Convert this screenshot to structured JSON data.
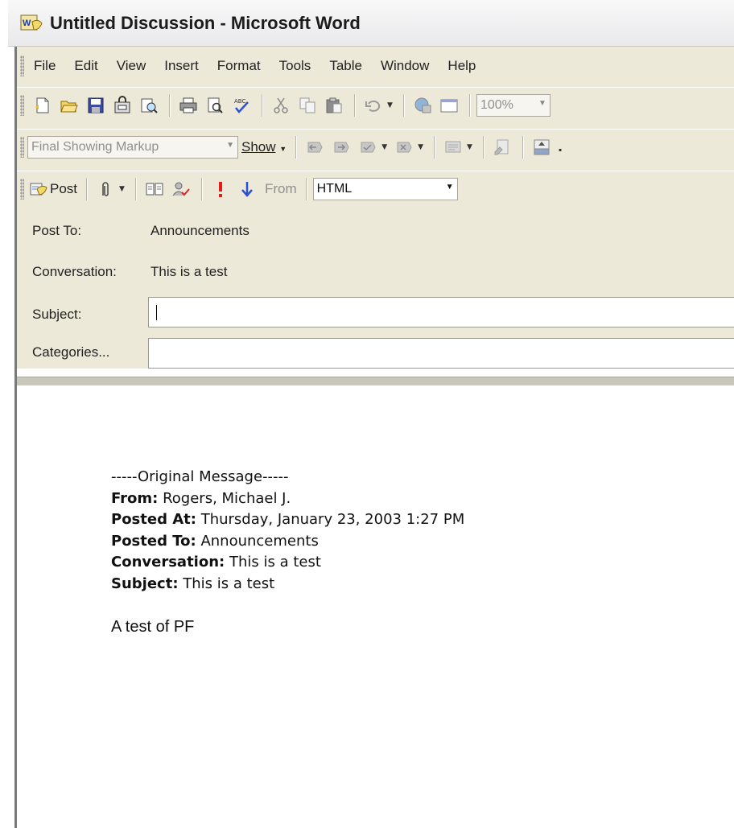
{
  "window": {
    "title": "Untitled Discussion - Microsoft Word",
    "app_icon": "word-discussion-icon"
  },
  "menubar": {
    "items": [
      "File",
      "Edit",
      "View",
      "Insert",
      "Format",
      "Tools",
      "Table",
      "Window",
      "Help"
    ]
  },
  "standard_toolbar": {
    "zoom": "100%",
    "icons": [
      "new-icon",
      "open-icon",
      "save-icon",
      "permission-icon",
      "search-icon",
      "print-icon",
      "print-preview-icon",
      "spelling-icon",
      "cut-icon",
      "copy-icon",
      "paste-icon",
      "undo-icon",
      "web-icon",
      "frame-icon"
    ]
  },
  "reviewing_toolbar": {
    "markup_view": "Final Showing Markup",
    "show_label": "Show"
  },
  "post_toolbar": {
    "post_label": "Post",
    "from_label": "From",
    "format": "HTML"
  },
  "header": {
    "post_to_label": "Post To:",
    "post_to_value": "Announcements",
    "conversation_label": "Conversation:",
    "conversation_value": "This is a test",
    "subject_label": "Subject:",
    "subject_value": "",
    "categories_label": "Categories...",
    "categories_value": ""
  },
  "message": {
    "separator": "-----Original Message-----",
    "from_label": "From:",
    "from_value": "Rogers, Michael J.",
    "posted_at_label": "Posted At:",
    "posted_at_value": "Thursday, January 23, 2003 1:27 PM",
    "posted_to_label": "Posted To:",
    "posted_to_value": "Announcements",
    "conversation_label": "Conversation:",
    "conversation_value": "This is a test",
    "subject_label": "Subject:",
    "subject_value": "This is a test",
    "body": "A test of PF"
  },
  "colors": {
    "toolbar_bg": "#ece9d8",
    "accent_red": "#e41b17",
    "accent_blue": "#2b4fd6"
  }
}
